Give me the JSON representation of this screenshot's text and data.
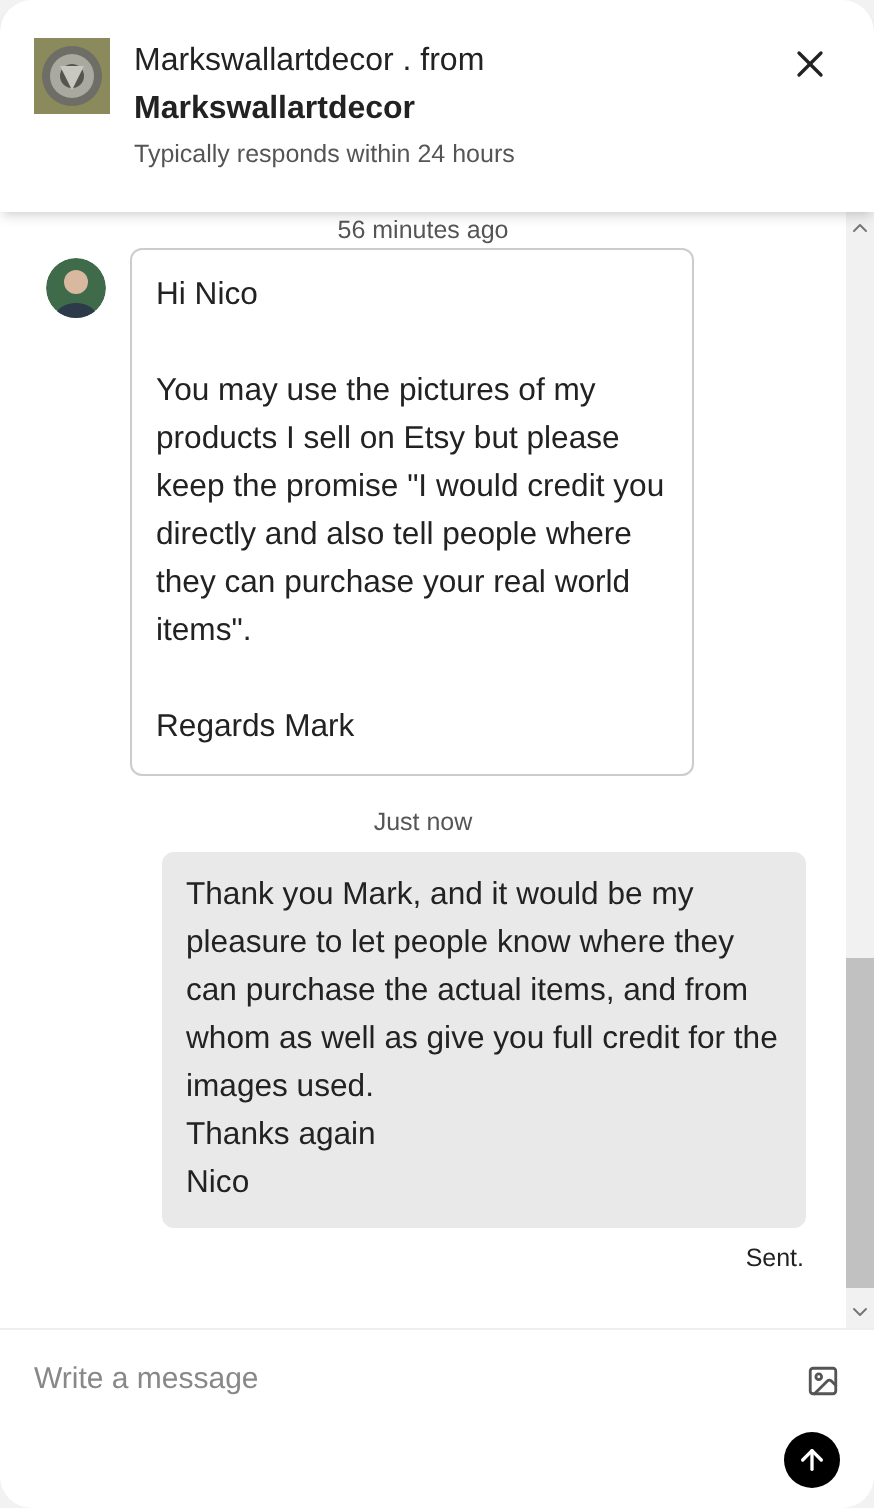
{
  "header": {
    "shop_line": "Markswallartdecor . from",
    "shop_name": "Markswallartdecor",
    "response_time": "Typically responds within 24 hours"
  },
  "messages": [
    {
      "kind": "received",
      "time": "56 minutes ago",
      "text": "Hi Nico\n\nYou may use the pictures of my products I sell on Etsy but please keep the promise \"I would credit you directly and also tell people where they can purchase your real world items\".\n\nRegards Mark"
    },
    {
      "kind": "sent",
      "time": "Just now",
      "text": "Thank you Mark, and it would be my pleasure to let people know where they can purchase the actual items, and from whom as well as give you full credit for the images used.\nThanks again\nNico",
      "status": "Sent."
    }
  ],
  "composer": {
    "placeholder": "Write a message"
  }
}
